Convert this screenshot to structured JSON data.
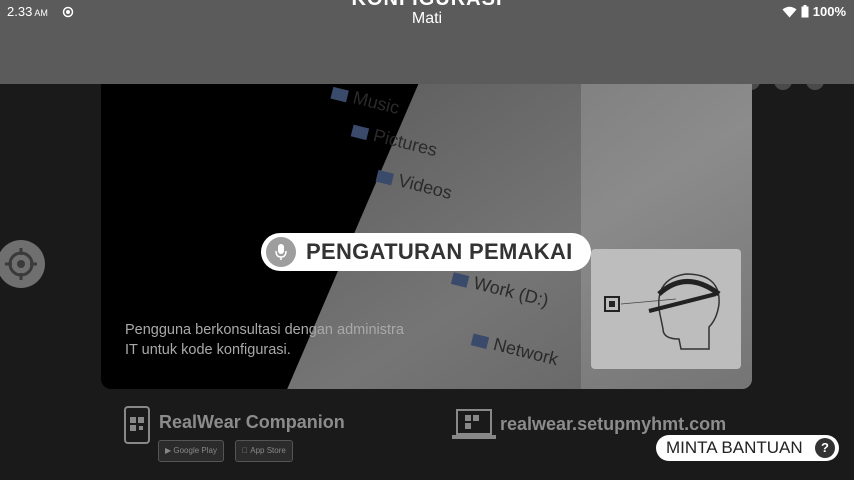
{
  "status": {
    "time": "2.33",
    "ampm": "AM",
    "battery": "100%"
  },
  "shade": {
    "title": "KONFIGURASI",
    "subtitle": "Mati"
  },
  "card": {
    "description_line1": "Pengguna berkonsultasi dengan administra",
    "description_line2": "IT untuk kode konfigurasi.",
    "explorer_items": [
      "Music",
      "Pictures",
      "Videos",
      "Work (D:)",
      "Network"
    ]
  },
  "companion": {
    "label": "RealWear Companion",
    "google_play": "Google Play",
    "app_store": "App Store"
  },
  "website": {
    "label": "realwear.setupmyhmt.com"
  },
  "voice_command": {
    "label": "PENGATURAN PEMAKAI"
  },
  "help": {
    "label": "MINTA BANTUAN",
    "icon_glyph": "?"
  },
  "icons": {
    "sync": "sync-icon",
    "wifi": "wifi-icon",
    "battery": "battery-icon",
    "mic": "mic-icon",
    "target": "crosshair-icon",
    "phone_qr": "phone-qr-icon",
    "laptop_qr": "laptop-qr-icon"
  },
  "colors": {
    "shade": "#5b5b5b",
    "pill": "#ffffff",
    "muted_text": "#8c8c8c"
  }
}
